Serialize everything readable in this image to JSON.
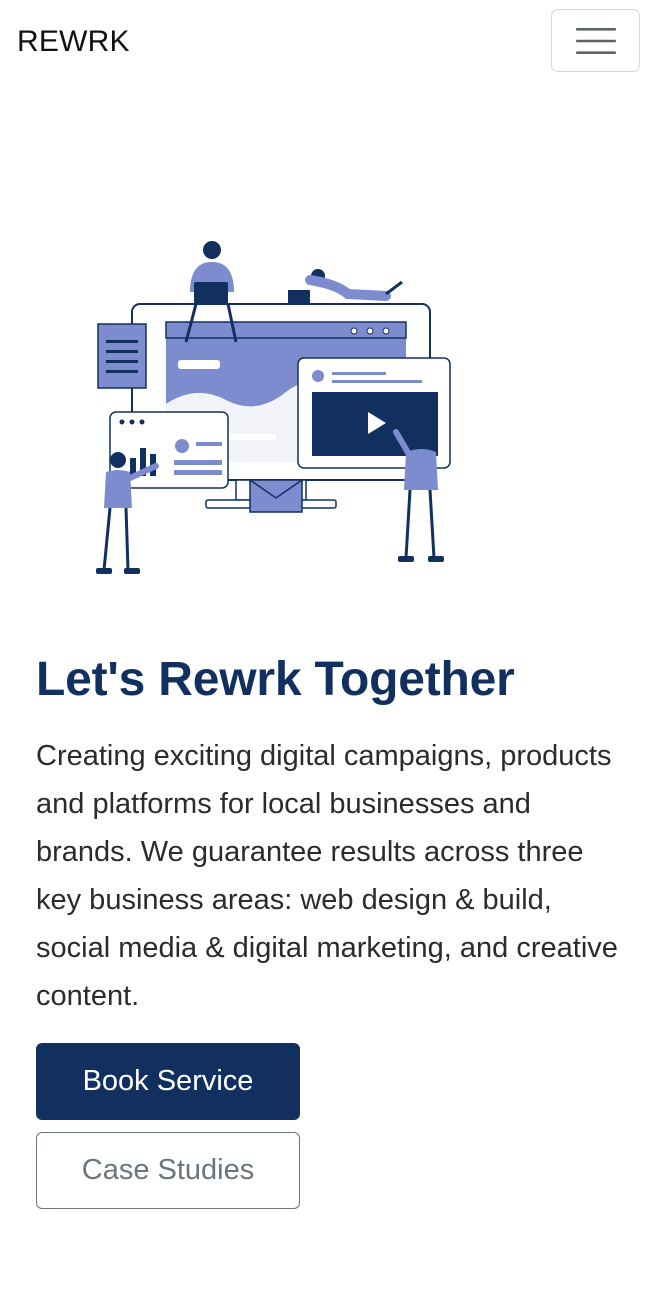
{
  "navbar": {
    "brand": "REWRK",
    "toggler_icon": "hamburger-menu-icon"
  },
  "hero": {
    "illustration_icon": "digital-team-illustration",
    "title": "Let's Rewrk Together",
    "description": "Creating exciting digital campaigns, products and platforms for local businesses and brands. We guarantee results across three key business areas: web design & build, social media & digital marketing, and creative content.",
    "primary_button": "Book Service",
    "secondary_button": "Case Studies"
  },
  "colors": {
    "brand_navy": "#12305f",
    "illustration_blue": "#7d8cce",
    "outline_gray": "#6c757d"
  }
}
